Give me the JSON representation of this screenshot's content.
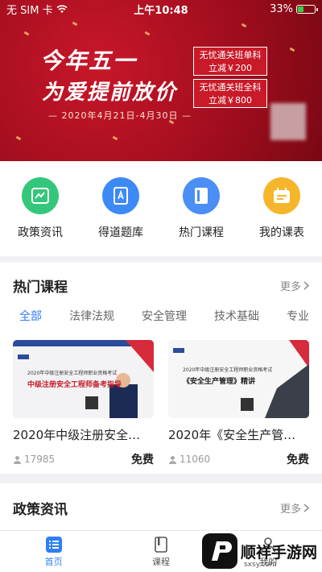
{
  "status_bar": {
    "carrier": "无 SIM 卡",
    "time": "上午10:48",
    "battery_pct": "33%",
    "battery_level": 0.33
  },
  "banner": {
    "headline_1": "今年五一",
    "headline_2": "为爱提前放价",
    "date_range": "— 2020年4月21日-4月30日 —",
    "promo_1_line1": "无忧通关班单科",
    "promo_1_line2": "立减￥200",
    "promo_2_line1": "无忧通关班全科",
    "promo_2_line2": "立减￥800"
  },
  "quick_nav": [
    {
      "label": "政策资讯",
      "color": "#34c77b",
      "icon": "news-icon"
    },
    {
      "label": "得道题库",
      "color": "#3d8af7",
      "icon": "question-bank-icon"
    },
    {
      "label": "热门课程",
      "color": "#4a8ef6",
      "icon": "course-book-icon"
    },
    {
      "label": "我的课表",
      "color": "#f6b62b",
      "icon": "schedule-icon"
    }
  ],
  "hot_courses": {
    "title": "热门课程",
    "more": "更多",
    "tabs": [
      "全部",
      "法律法规",
      "安全管理",
      "技术基础",
      "专业"
    ],
    "cards": [
      {
        "title": "2020年中级注册安全…",
        "views": "17985",
        "price": "免费",
        "thumb_line1": "2020年中级注册安全工程师职业资格考试",
        "thumb_line2": "中级注册安全工程师备考指导"
      },
      {
        "title": "2020年《安全生产管…",
        "views": "11060",
        "price": "免费",
        "thumb_line1": "2020年中级注册安全工程师职业资格考试",
        "thumb_line2": "《安全生产管理》精讲"
      }
    ]
  },
  "policy": {
    "title": "政策资讯",
    "more": "更多"
  },
  "tab_bar": [
    {
      "label": "首页",
      "active": true
    },
    {
      "label": "课程",
      "active": false
    },
    {
      "label": "我的",
      "active": false
    }
  ],
  "watermark": {
    "text": "顺祥手游网",
    "sub": "sxsy.com"
  },
  "colors": {
    "accent": "#2f7ef5",
    "banner_red": "#b3121f"
  }
}
